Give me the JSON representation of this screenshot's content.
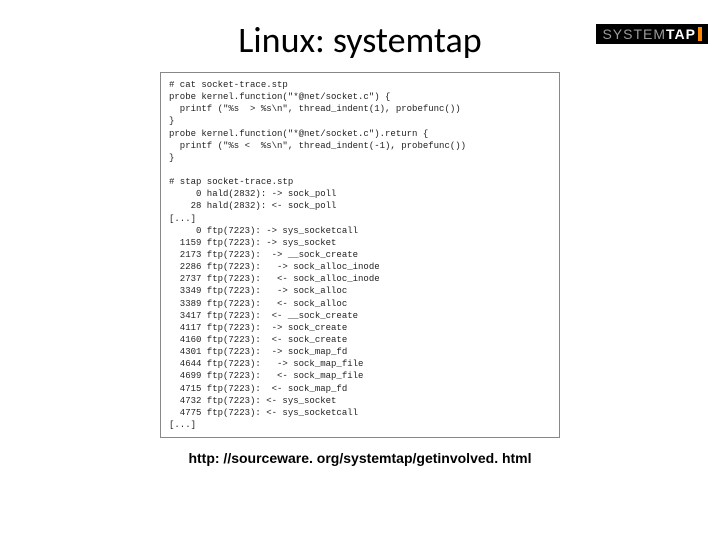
{
  "logo": {
    "system": "SYSTEM",
    "tap": "TAP"
  },
  "title": "Linux: systemtap",
  "code": "# cat socket-trace.stp\nprobe kernel.function(\"*@net/socket.c\") {\n  printf (\"%s  > %s\\n\", thread_indent(1), probefunc())\n}\nprobe kernel.function(\"*@net/socket.c\").return {\n  printf (\"%s <  %s\\n\", thread_indent(-1), probefunc())\n}\n\n# stap socket-trace.stp\n     0 hald(2832): -> sock_poll\n    28 hald(2832): <- sock_poll\n[...]\n     0 ftp(7223): -> sys_socketcall\n  1159 ftp(7223): -> sys_socket\n  2173 ftp(7223):  -> __sock_create\n  2286 ftp(7223):   -> sock_alloc_inode\n  2737 ftp(7223):   <- sock_alloc_inode\n  3349 ftp(7223):   -> sock_alloc\n  3389 ftp(7223):   <- sock_alloc\n  3417 ftp(7223):  <- __sock_create\n  4117 ftp(7223):  -> sock_create\n  4160 ftp(7223):  <- sock_create\n  4301 ftp(7223):  -> sock_map_fd\n  4644 ftp(7223):   -> sock_map_file\n  4699 ftp(7223):   <- sock_map_file\n  4715 ftp(7223):  <- sock_map_fd\n  4732 ftp(7223): <- sys_socket\n  4775 ftp(7223): <- sys_socketcall\n[...]",
  "footer": "http: //sourceware. org/systemtap/getinvolved. html"
}
